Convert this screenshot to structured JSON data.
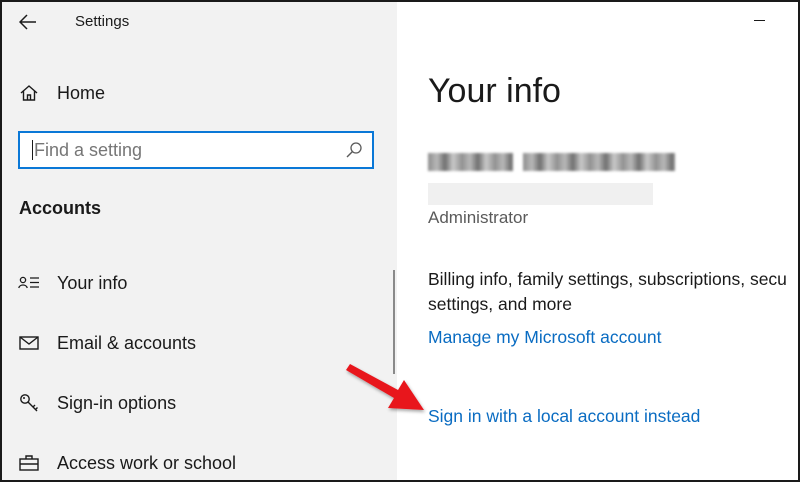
{
  "window": {
    "title": "Settings"
  },
  "sidebar": {
    "home_label": "Home",
    "search": {
      "placeholder": "Find a setting",
      "value": ""
    },
    "section_heading": "Accounts",
    "items": [
      {
        "label": "Your info",
        "icon": "person-list-icon"
      },
      {
        "label": "Email & accounts",
        "icon": "mail-icon"
      },
      {
        "label": "Sign-in options",
        "icon": "key-icon"
      },
      {
        "label": "Access work or school",
        "icon": "briefcase-icon"
      }
    ]
  },
  "main": {
    "title": "Your info",
    "role": "Administrator",
    "billing_lines": [
      "Billing info, family settings, subscriptions, secu",
      "settings, and more"
    ],
    "manage_link": "Manage my Microsoft account",
    "local_account_link": "Sign in with a local account instead"
  },
  "colors": {
    "sidebar_bg": "#f2f2f2",
    "accent": "#0a78d7",
    "link": "#0a6cc2",
    "annotation_arrow": "#e8141c"
  }
}
